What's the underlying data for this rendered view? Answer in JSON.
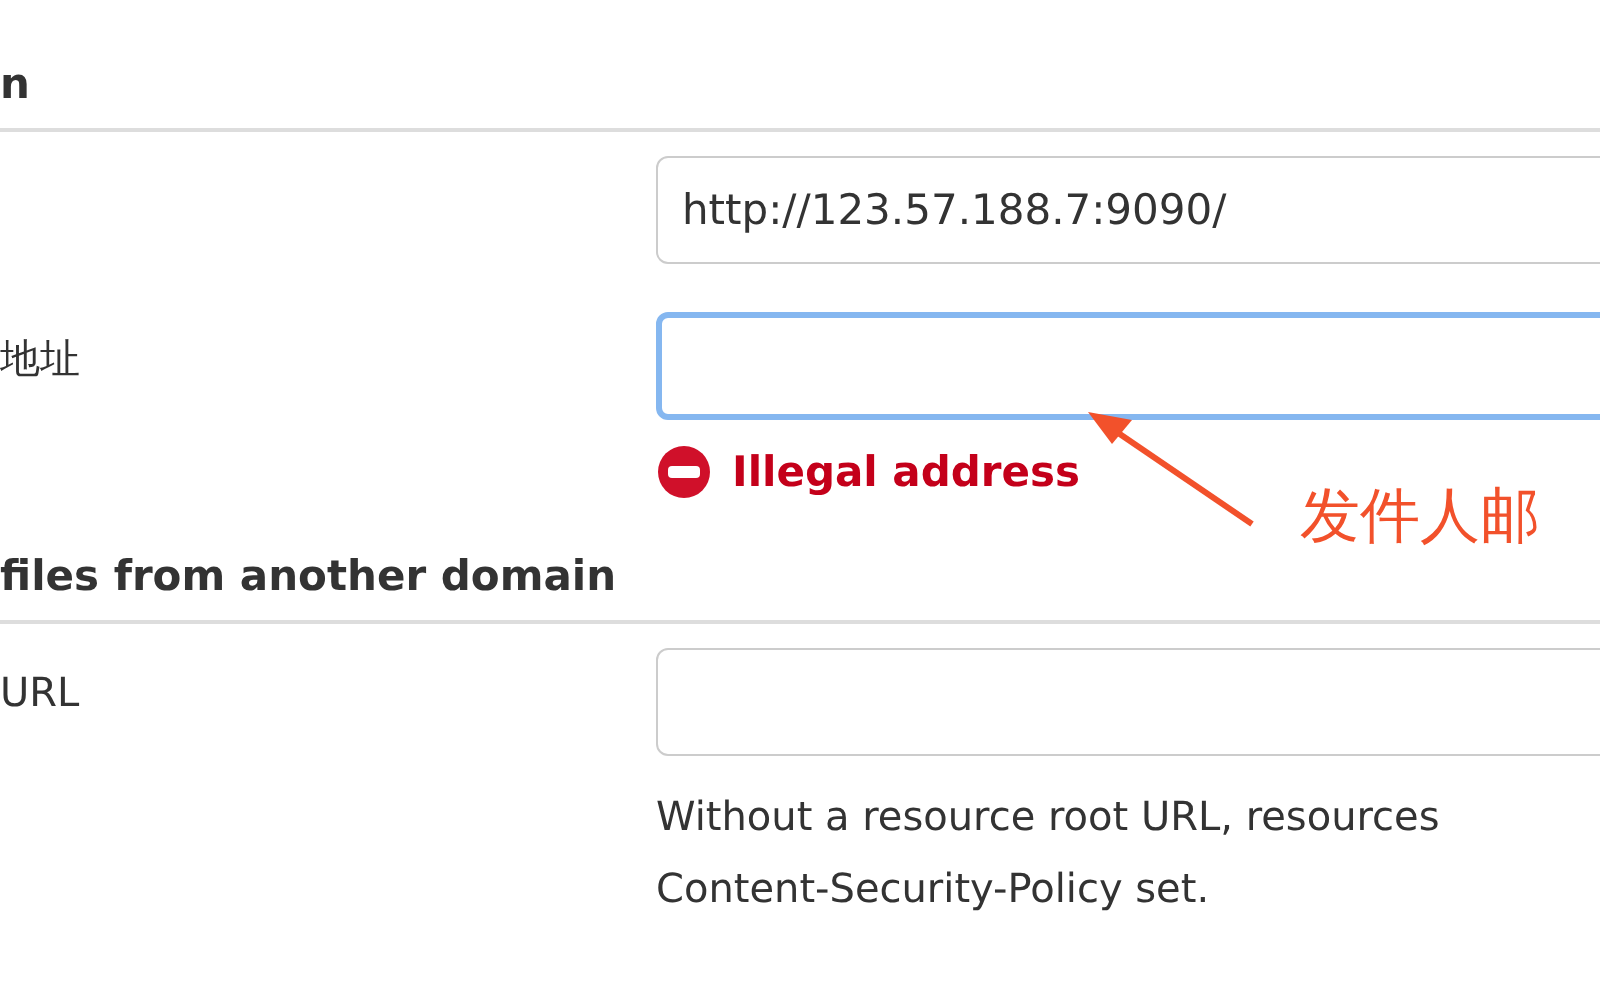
{
  "sections": [
    {
      "heading": "n",
      "rows": [
        {
          "focused": false,
          "text": "http://123.57.188.7:9090/"
        },
        {
          "label": "地址",
          "focused": true,
          "error": "Illegal address"
        }
      ]
    },
    {
      "heading": "files from another domain",
      "rows": [
        {
          "label": "URL",
          "focused": false,
          "help": [
            "Without a resource root URL, resources",
            "Content-Security-Policy set."
          ]
        }
      ]
    }
  ],
  "annotation": {
    "text": "发件人邮"
  }
}
